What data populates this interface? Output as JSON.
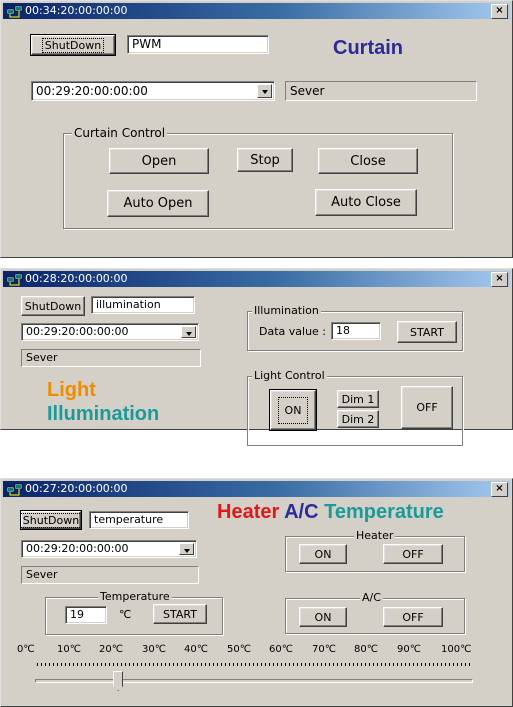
{
  "window1": {
    "title": "00:34:20:00:00:00",
    "shutdown_label": "ShutDown",
    "mode_value": "PWM",
    "heading": "Curtain",
    "heading_color": "#2b2b9a",
    "time_combo_value": "00:29:20:00:00:00",
    "status_text": "Sever",
    "group_label": "Curtain Control",
    "open_label": "Open",
    "stop_label": "Stop",
    "close_label": "Close",
    "auto_open_label": "Auto Open",
    "auto_close_label": "Auto Close"
  },
  "window2": {
    "title": "00:28:20:00:00:00",
    "shutdown_label": "ShutDown",
    "mode_value": "illumination",
    "time_combo_value": "00:29:20:00:00:00",
    "status_text": "Sever",
    "illum_group_label": "Illumination",
    "data_value_label": "Data value :",
    "data_value": "18",
    "start_label": "START",
    "light_group_label": "Light Control",
    "on_label": "ON",
    "dim1_label": "Dim 1",
    "dim2_label": "Dim 2",
    "off_label": "OFF",
    "heading_line1": "Light",
    "heading_line2": "Illumination",
    "heading_line1_color": "#f08c00",
    "heading_line2_color": "#1a9a9a"
  },
  "window3": {
    "title": "00:27:20:00:00:00",
    "shutdown_label": "ShutDown",
    "mode_value": "temperature",
    "heading_heater": "Heater",
    "heading_ac": "A/C",
    "heading_temp": "Temperature",
    "heading_heater_color": "#e01818",
    "heading_ac_color": "#2b2b9a",
    "heading_temp_color": "#1a9a9a",
    "time_combo_value": "00:29:20:00:00:00",
    "status_text": "Sever",
    "heater_group_label": "Heater",
    "heater_on_label": "ON",
    "heater_off_label": "OFF",
    "temp_group_label": "Temperature",
    "temp_value": "19",
    "temp_unit": "℃",
    "start_label": "START",
    "ac_group_label": "A/C",
    "ac_on_label": "ON",
    "ac_off_label": "OFF",
    "scale_ticks": [
      "0℃",
      "10℃",
      "20℃",
      "30℃",
      "40℃",
      "50℃",
      "60℃",
      "70℃",
      "80℃",
      "90℃",
      "100℃"
    ],
    "slider_value_celsius": 19
  },
  "icons": {
    "app_icon": "network-computers-icon",
    "close_icon": "close-x-icon"
  }
}
